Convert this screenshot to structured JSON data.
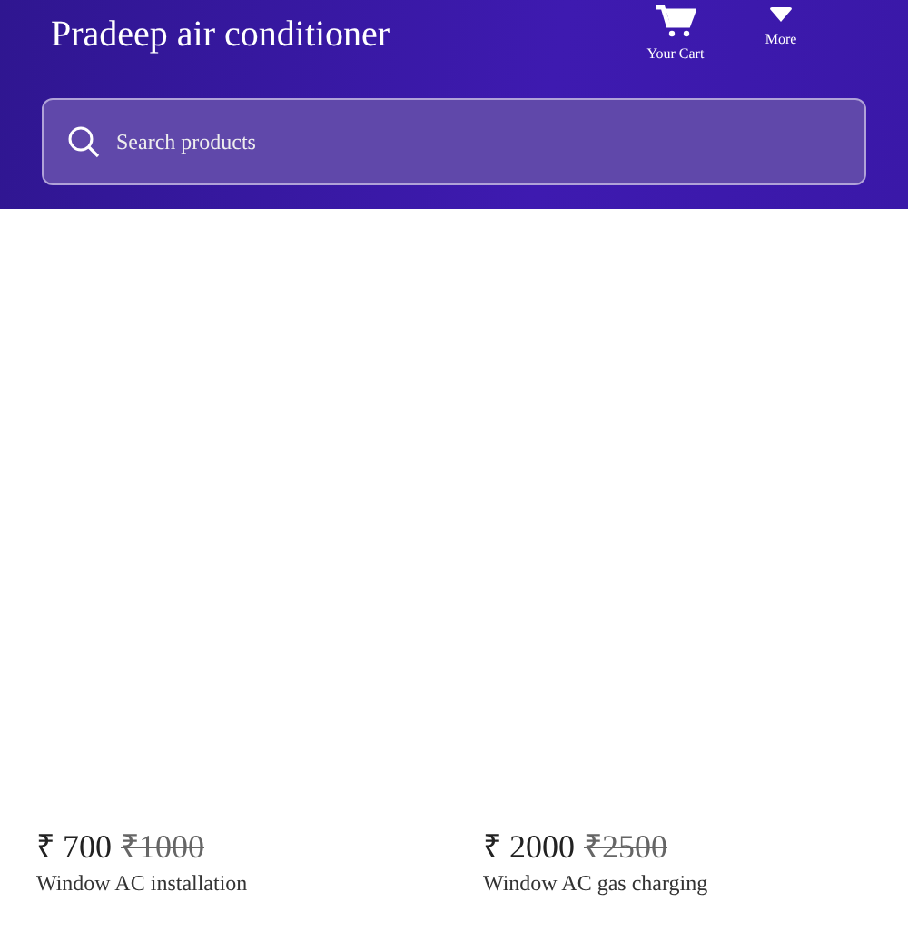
{
  "header": {
    "title": "Pradeep air conditioner",
    "actions": [
      {
        "kind": "cart",
        "label": "Your Cart"
      },
      {
        "kind": "more",
        "label": "More"
      }
    ]
  },
  "search": {
    "placeholder": "Search products"
  },
  "products": [
    {
      "price": "₹ 700",
      "old_price": "₹1000",
      "name": "Window AC installation"
    },
    {
      "price": "₹ 2000",
      "old_price": "₹2500",
      "name": "Window AC gas charging"
    }
  ]
}
